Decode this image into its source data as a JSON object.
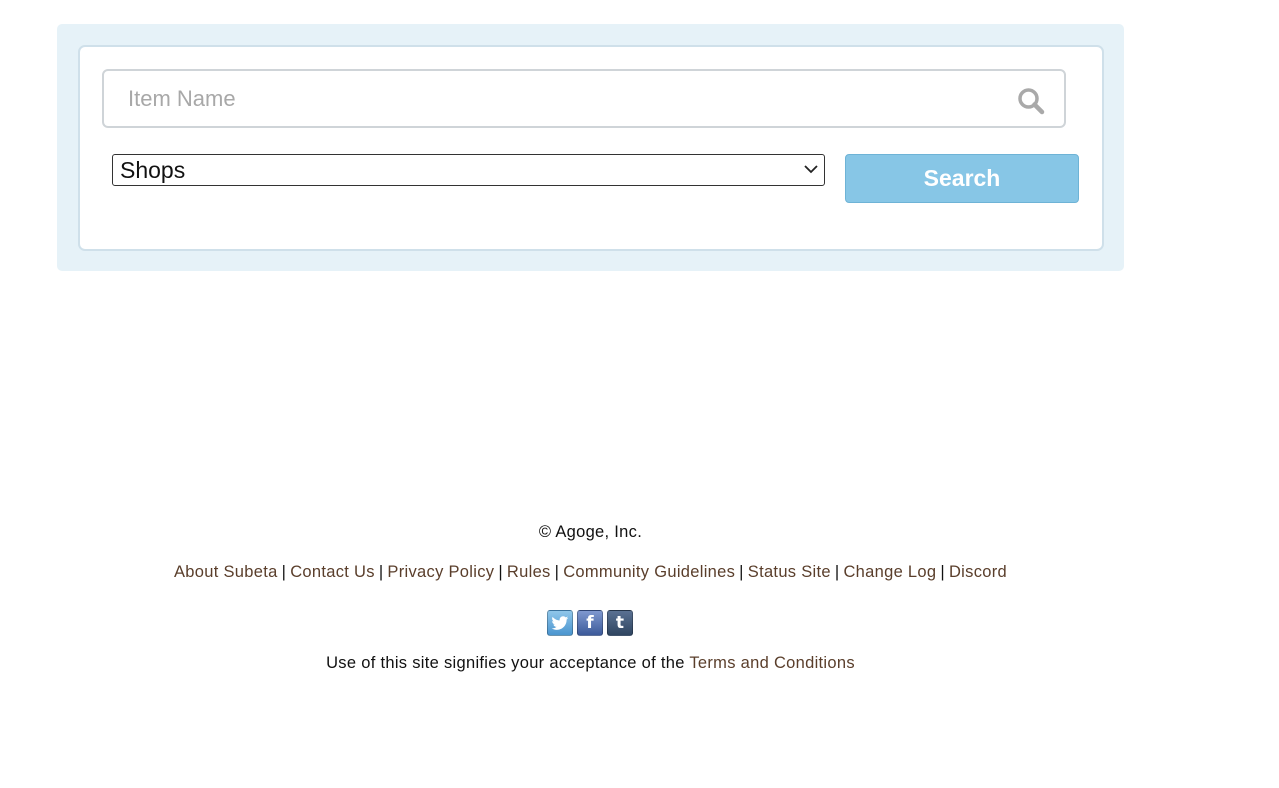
{
  "search": {
    "placeholder": "Item Name",
    "value": "",
    "icon": "search-icon"
  },
  "category_select": {
    "selected": "Shops",
    "icon": "chevron-down-icon"
  },
  "search_button": {
    "label": "Search"
  },
  "footer": {
    "copyright": "© Agoge, Inc.",
    "links": [
      {
        "label": "About Subeta"
      },
      {
        "label": "Contact Us"
      },
      {
        "label": "Privacy Policy"
      },
      {
        "label": "Rules"
      },
      {
        "label": "Community Guidelines"
      },
      {
        "label": "Status Site"
      },
      {
        "label": "Change Log"
      },
      {
        "label": "Discord"
      }
    ],
    "separator": "|",
    "social": [
      {
        "name": "twitter-icon",
        "glyph": "🐦"
      },
      {
        "name": "facebook-icon",
        "glyph": "f"
      },
      {
        "name": "tumblr-icon",
        "glyph": "t"
      }
    ],
    "terms_prefix": "Use of this site signifies your acceptance of the",
    "terms_link": "Terms and Conditions"
  },
  "colors": {
    "panel_bg": "#e6f2f8",
    "button_bg": "#87c6e6",
    "link": "#5a3e2b"
  }
}
